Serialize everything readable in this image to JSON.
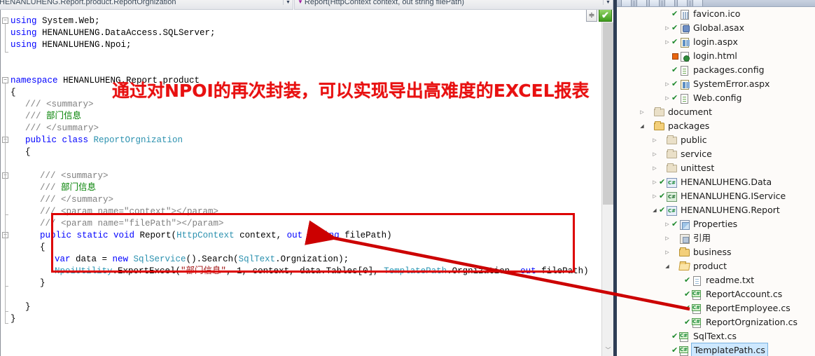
{
  "navbars": {
    "type_selector": {
      "value": "HENANLUHENG.Report.product.ReportOrgnization",
      "arrow": "▼"
    },
    "member_selector": {
      "glyph": "▼",
      "value": "Report(HttpContext context, out string filePath)",
      "arrow": "▼"
    }
  },
  "annotation": {
    "text": "通过对NPOI的再次封装，可以实现导出高难度的EXCEL报表",
    "color": "#e81010"
  },
  "highlight_box": {
    "color": "#dd0000"
  },
  "arrow": {
    "color": "#cc0000"
  },
  "editor": {
    "scrollbar": {
      "up": "︿",
      "down": "﹀"
    },
    "split_control": "≑",
    "ok_mark": "✔",
    "lines": [
      {
        "indent": 0,
        "tokens": [
          {
            "t": "using ",
            "c": "kw"
          },
          {
            "t": "System.Web;",
            "c": ""
          }
        ]
      },
      {
        "indent": 0,
        "tokens": [
          {
            "t": "using ",
            "c": "kw"
          },
          {
            "t": "HENANLUHENG.DataAccess.SQLServer;",
            "c": ""
          }
        ]
      },
      {
        "indent": 0,
        "tokens": [
          {
            "t": "using ",
            "c": "kw"
          },
          {
            "t": "HENANLUHENG.Npoi;",
            "c": ""
          }
        ]
      },
      {
        "indent": 0,
        "tokens": []
      },
      {
        "indent": 0,
        "tokens": []
      },
      {
        "indent": 0,
        "tokens": [
          {
            "t": "namespace ",
            "c": "kw"
          },
          {
            "t": "HENANLUHENG.Report.product",
            "c": ""
          }
        ]
      },
      {
        "indent": 0,
        "tokens": [
          {
            "t": "{",
            "c": ""
          }
        ]
      },
      {
        "indent": 1,
        "tokens": [
          {
            "t": "/// ",
            "c": "cmt"
          },
          {
            "t": "<summary>",
            "c": "cmt"
          }
        ]
      },
      {
        "indent": 1,
        "tokens": [
          {
            "t": "/// ",
            "c": "cmt"
          },
          {
            "t": "部门信息",
            "c": "cmtcn"
          }
        ]
      },
      {
        "indent": 1,
        "tokens": [
          {
            "t": "/// ",
            "c": "cmt"
          },
          {
            "t": "</summary>",
            "c": "cmt"
          }
        ]
      },
      {
        "indent": 1,
        "tokens": [
          {
            "t": "public ",
            "c": "kw"
          },
          {
            "t": "class ",
            "c": "kw"
          },
          {
            "t": "ReportOrgnization",
            "c": "type"
          }
        ]
      },
      {
        "indent": 1,
        "tokens": [
          {
            "t": "{",
            "c": ""
          }
        ]
      },
      {
        "indent": 0,
        "tokens": []
      },
      {
        "indent": 2,
        "tokens": [
          {
            "t": "/// ",
            "c": "cmt"
          },
          {
            "t": "<summary>",
            "c": "cmt"
          }
        ]
      },
      {
        "indent": 2,
        "tokens": [
          {
            "t": "/// ",
            "c": "cmt"
          },
          {
            "t": "部门信息",
            "c": "cmtcn"
          }
        ]
      },
      {
        "indent": 2,
        "tokens": [
          {
            "t": "/// ",
            "c": "cmt"
          },
          {
            "t": "</summary>",
            "c": "cmt"
          }
        ]
      },
      {
        "indent": 2,
        "tokens": [
          {
            "t": "/// ",
            "c": "cmt"
          },
          {
            "t": "<param name=\"context\"></param>",
            "c": "cmt"
          }
        ]
      },
      {
        "indent": 2,
        "tokens": [
          {
            "t": "/// ",
            "c": "cmt"
          },
          {
            "t": "<param name=\"filePath\"></param>",
            "c": "cmt"
          }
        ]
      },
      {
        "indent": 2,
        "tokens": [
          {
            "t": "public ",
            "c": "kw"
          },
          {
            "t": "static ",
            "c": "kw"
          },
          {
            "t": "void ",
            "c": "kw"
          },
          {
            "t": "Report(",
            "c": ""
          },
          {
            "t": "HttpContext",
            "c": "type"
          },
          {
            "t": " context, ",
            "c": ""
          },
          {
            "t": "out ",
            "c": "kw"
          },
          {
            "t": "string",
            "c": "kw"
          },
          {
            "t": " filePath)",
            "c": ""
          }
        ]
      },
      {
        "indent": 2,
        "tokens": [
          {
            "t": "{",
            "c": ""
          }
        ]
      },
      {
        "indent": 3,
        "tokens": [
          {
            "t": "var",
            "c": "kw"
          },
          {
            "t": " data = ",
            "c": ""
          },
          {
            "t": "new ",
            "c": "kw"
          },
          {
            "t": "SqlService",
            "c": "type"
          },
          {
            "t": "().Search(",
            "c": ""
          },
          {
            "t": "SqlText",
            "c": "type"
          },
          {
            "t": ".Orgnization);",
            "c": ""
          }
        ]
      },
      {
        "indent": 3,
        "tokens": [
          {
            "t": "NpoiUtility",
            "c": "type"
          },
          {
            "t": ".ExportExcel(",
            "c": ""
          },
          {
            "t": "\"部门信息\"",
            "c": "str"
          },
          {
            "t": ", 1, context, data.Tables[0], ",
            "c": ""
          },
          {
            "t": "TemplatePath",
            "c": "type"
          },
          {
            "t": ".Orgnization, ",
            "c": ""
          },
          {
            "t": "out",
            "c": "kw"
          },
          {
            "t": " filePath)",
            "c": ""
          }
        ]
      },
      {
        "indent": 2,
        "tokens": [
          {
            "t": "}",
            "c": ""
          }
        ]
      },
      {
        "indent": 0,
        "tokens": []
      },
      {
        "indent": 1,
        "tokens": [
          {
            "t": "}",
            "c": ""
          }
        ]
      },
      {
        "indent": 0,
        "tokens": [
          {
            "t": "}",
            "c": ""
          }
        ]
      }
    ]
  },
  "explorer": {
    "toolbar_buttons": [
      "properties-button",
      "show-all-files-button",
      "refresh-button",
      "collapse-button",
      "view-code-button",
      "preview-button"
    ],
    "tree": [
      {
        "depth": 3,
        "expander": "",
        "check": "tick",
        "icon": "grid",
        "label": "favicon.ico",
        "selected": false
      },
      {
        "depth": 3,
        "expander": "▷",
        "check": "tick",
        "icon": "gear-doc",
        "label": "Global.asax",
        "selected": false
      },
      {
        "depth": 3,
        "expander": "▷",
        "check": "tick",
        "icon": "aspx",
        "label": "login.aspx",
        "selected": false
      },
      {
        "depth": 3,
        "expander": "",
        "check": "red",
        "icon": "globe",
        "label": "login.html",
        "selected": false
      },
      {
        "depth": 3,
        "expander": "",
        "check": "tick",
        "icon": "config",
        "label": "packages.config",
        "selected": false
      },
      {
        "depth": 3,
        "expander": "▷",
        "check": "tick",
        "icon": "aspx",
        "label": "SystemError.aspx",
        "selected": false
      },
      {
        "depth": 3,
        "expander": "▷",
        "check": "tick",
        "icon": "config",
        "label": "Web.config",
        "selected": false
      },
      {
        "depth": 1,
        "expander": "▷",
        "check": "",
        "icon": "folder-grey",
        "label": "document",
        "selected": false
      },
      {
        "depth": 1,
        "expander": "◢",
        "check": "",
        "icon": "folder",
        "label": "packages",
        "selected": false
      },
      {
        "depth": 2,
        "expander": "▷",
        "check": "",
        "icon": "folder-grey",
        "label": "public",
        "selected": false
      },
      {
        "depth": 2,
        "expander": "▷",
        "check": "",
        "icon": "folder-grey",
        "label": "service",
        "selected": false
      },
      {
        "depth": 2,
        "expander": "▷",
        "check": "",
        "icon": "folder-grey",
        "label": "unittest",
        "selected": false
      },
      {
        "depth": 2,
        "expander": "▷",
        "check": "tick",
        "icon": "proj",
        "label": "HENANLUHENG.Data",
        "selected": false
      },
      {
        "depth": 2,
        "expander": "▷",
        "check": "tick",
        "icon": "proj-svc",
        "label": "HENANLUHENG.IService",
        "selected": false
      },
      {
        "depth": 2,
        "expander": "◢",
        "check": "tick",
        "icon": "proj",
        "label": "HENANLUHENG.Report",
        "selected": false
      },
      {
        "depth": 3,
        "expander": "▷",
        "check": "tick",
        "icon": "props",
        "label": "Properties",
        "selected": false
      },
      {
        "depth": 3,
        "expander": "▷",
        "check": "",
        "icon": "refs",
        "label": "引用",
        "selected": false
      },
      {
        "depth": 3,
        "expander": "▷",
        "check": "",
        "icon": "folder",
        "label": "business",
        "selected": false
      },
      {
        "depth": 3,
        "expander": "◢",
        "check": "",
        "icon": "folder-open",
        "label": "product",
        "selected": false
      },
      {
        "depth": 4,
        "expander": "",
        "check": "tick",
        "icon": "doc",
        "label": "readme.txt",
        "selected": false
      },
      {
        "depth": 4,
        "expander": "",
        "check": "tick",
        "icon": "cs",
        "label": "ReportAccount.cs",
        "selected": false
      },
      {
        "depth": 4,
        "expander": "",
        "check": "tick",
        "icon": "cs",
        "label": "ReportEmployee.cs",
        "selected": false
      },
      {
        "depth": 4,
        "expander": "",
        "check": "tick",
        "icon": "cs",
        "label": "ReportOrgnization.cs",
        "selected": false
      },
      {
        "depth": 3,
        "expander": "",
        "check": "tick",
        "icon": "cs",
        "label": "SqlText.cs",
        "selected": false
      },
      {
        "depth": 3,
        "expander": "",
        "check": "tick",
        "icon": "cs",
        "label": "TemplatePath.cs",
        "selected": true
      }
    ]
  }
}
